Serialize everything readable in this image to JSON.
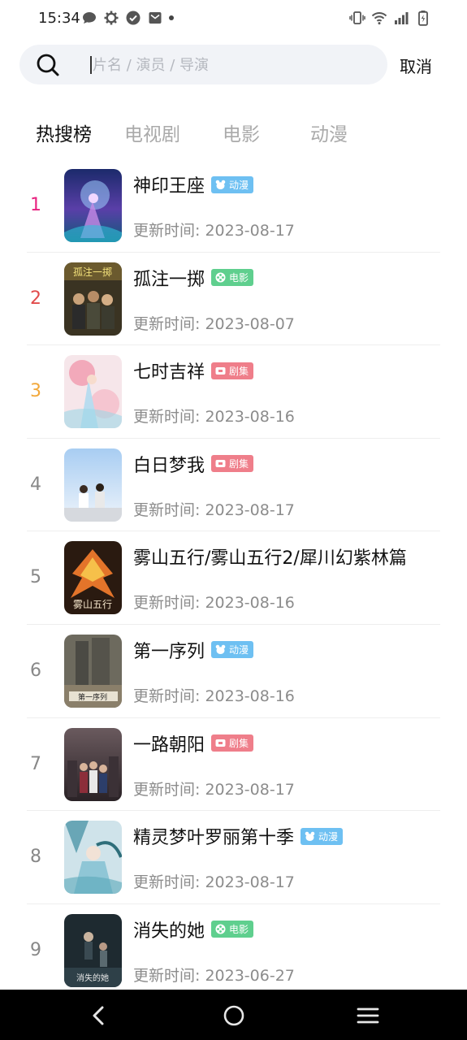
{
  "status_bar": {
    "time": "15:34",
    "left_icons": [
      "message-icon",
      "settings-icon",
      "check-circle-icon",
      "mail-icon",
      "dot-icon"
    ],
    "right_icons": [
      "vibrate-icon",
      "wifi-icon",
      "signal-icon",
      "battery-icon"
    ]
  },
  "search": {
    "placeholder": "片名 / 演员 / 导演",
    "value": "",
    "cancel_label": "取消"
  },
  "tabs": [
    {
      "label": "热搜榜",
      "active": true
    },
    {
      "label": "电视剧",
      "active": false
    },
    {
      "label": "电影",
      "active": false
    },
    {
      "label": "动漫",
      "active": false
    }
  ],
  "colors": {
    "rank_1": "#e8217f",
    "rank_2": "#e14b4b",
    "rank_3": "#f2a83b",
    "rank_default": "#888888",
    "badge_anime": "#6ec0f2",
    "badge_movie": "#5fcf8e",
    "badge_series": "#ef7e8a"
  },
  "list": [
    {
      "rank": "1",
      "title": "神印王座",
      "badge": "动漫",
      "badge_type": "anime",
      "update_label": "更新时间:",
      "date": "2023-08-17"
    },
    {
      "rank": "2",
      "title": "孤注一掷",
      "badge": "电影",
      "badge_type": "movie",
      "update_label": "更新时间:",
      "date": "2023-08-07"
    },
    {
      "rank": "3",
      "title": "七时吉祥",
      "badge": "剧集",
      "badge_type": "series",
      "update_label": "更新时间:",
      "date": "2023-08-16"
    },
    {
      "rank": "4",
      "title": "白日梦我",
      "badge": "剧集",
      "badge_type": "series",
      "update_label": "更新时间:",
      "date": "2023-08-17"
    },
    {
      "rank": "5",
      "title": "雾山五行/雾山五行2/犀川幻紫林篇",
      "badge": "",
      "badge_type": "none",
      "update_label": "更新时间:",
      "date": "2023-08-16"
    },
    {
      "rank": "6",
      "title": "第一序列",
      "badge": "动漫",
      "badge_type": "anime",
      "update_label": "更新时间:",
      "date": "2023-08-16"
    },
    {
      "rank": "7",
      "title": "一路朝阳",
      "badge": "剧集",
      "badge_type": "series",
      "update_label": "更新时间:",
      "date": "2023-08-17"
    },
    {
      "rank": "8",
      "title": "精灵梦叶罗丽第十季",
      "badge": "动漫",
      "badge_type": "anime",
      "update_label": "更新时间:",
      "date": "2023-08-17"
    },
    {
      "rank": "9",
      "title": "消失的她",
      "badge": "电影",
      "badge_type": "movie",
      "update_label": "更新时间:",
      "date": "2023-06-27"
    }
  ],
  "nav_bar": {
    "buttons": [
      "back-icon",
      "home-icon",
      "menu-icon"
    ]
  }
}
